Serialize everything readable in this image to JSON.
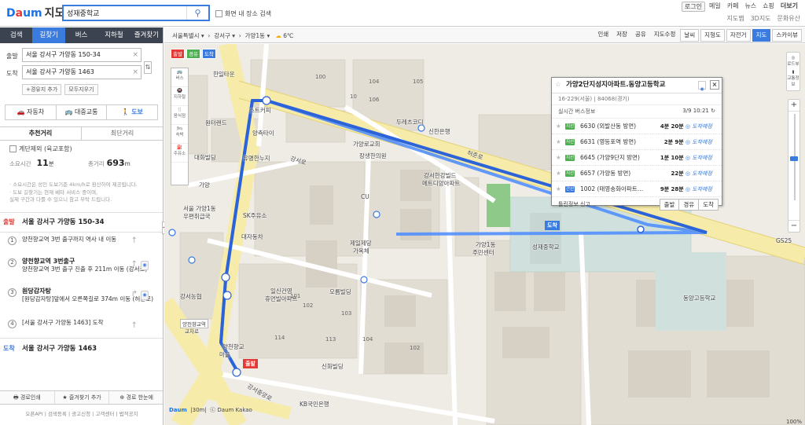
{
  "header": {
    "logo": "Daum",
    "logo_suffix": "지도",
    "search_value": "성재중학교",
    "checkbox_label": "화면 내 장소 검색",
    "links_top": [
      "로그인",
      "메일",
      "카페",
      "뉴스",
      "쇼핑",
      "더보기"
    ],
    "links_sub": [
      "지도맵",
      "3D지도",
      "문화유산"
    ]
  },
  "left": {
    "tabs": [
      "검색",
      "길찾기",
      "버스",
      "지하철",
      "즐겨찾기"
    ],
    "start_label": "출발",
    "start_value": "서울 강서구 가양동 150-34",
    "dest_label": "도착",
    "dest_value": "서울 강서구 가양동 1463",
    "add_waypoint": "+경유지 추가",
    "reset": "모두지우기",
    "modes": [
      "자동차",
      "대중교통",
      "도보"
    ],
    "sub_tabs": [
      "추천거리",
      "최단거리"
    ],
    "stairs_label": "계단제외 (육교포함)",
    "time_label": "소요시간",
    "time_value": "11",
    "time_unit": "분",
    "dist_label": "총거리",
    "dist_value": "693",
    "dist_unit": "m",
    "notice": [
      "· 소요시간은 성인 도보기준 4km/h로 환산하여 제공됩니다.",
      "· 도보 길찾기는 현재 베타 서비스 중이며,",
      "  실제 구간과 다를 수 있으니 참고 부탁 드립니다."
    ],
    "start_tag": "출발",
    "start_step": "서울 강서구 가양동 150-34",
    "steps": [
      {
        "num": "1",
        "title": "",
        "text": "양천향교역 3번 출구까지 역사 내 이동"
      },
      {
        "num": "2",
        "title": "양천향교역 3번출구",
        "text": "양천향교역 3번 출구 진출 후 211m 이동 (강서로)"
      },
      {
        "num": "3",
        "title": "원당감자탕",
        "text": "[원당감자탕]앞에서 오른쪽길로 374m 이동 (허준로)"
      },
      {
        "num": "4",
        "title": "",
        "text": "[서울 강서구 가양동 1463] 도착"
      }
    ],
    "dest_tag": "도착",
    "dest_step": "서울 강서구 가양동 1463",
    "footer_buttons": [
      "경로인쇄",
      "즐겨찾기 추가",
      "경로 한눈에"
    ],
    "footer_links": "오픈API | 검색등록 | 광고신청 | 고객센터 | 법적공지"
  },
  "mapbar": {
    "crumb": [
      "서울특별시",
      "강서구",
      "가양1동"
    ],
    "temp": "6℃",
    "tools": [
      "인쇄",
      "저장",
      "공유",
      "지도수정"
    ],
    "layers": [
      "날씨",
      "지형도",
      "자전거"
    ],
    "types": [
      "지도",
      "스카이뷰"
    ]
  },
  "map": {
    "route_buttons": [
      "출발",
      "경유",
      "도착"
    ],
    "vtools": [
      "버스",
      "지하철",
      "음식점",
      "숙박",
      "주유소"
    ],
    "labels": [
      "한일타운",
      "원터랜드",
      "스트커피",
      "연산",
      "양측타이",
      "유명한누지",
      "수해기",
      "대화빌딩",
      "가양",
      "중문",
      "서울 가양1동",
      "우편취급국",
      "SK주유소",
      "대자동차",
      "강서초",
      "강서농협",
      "양천향교역",
      "교차로",
      "양천향교",
      "마을",
      "신향교",
      "대포스역",
      "KB국민은행",
      "신화빌딩",
      "일신건영",
      "휴먼빌아파트",
      "일인로",
      "오름빌딩",
      "두레츠코디",
      "신한은행",
      "가양로교회",
      "장생한의원",
      "강서한강빌드",
      "메트디앙아파트",
      "CU",
      "제일제당",
      "가옥체",
      "가양1동",
      "주민센터",
      "성재중학교",
      "동양고등학교",
      "허준로",
      "강서로",
      "GS25",
      "강서중앙로"
    ],
    "numbers": [
      "100",
      "10",
      "104",
      "105",
      "106",
      "101",
      "102",
      "103",
      "114",
      "113",
      "104",
      "102",
      "101",
      "103",
      "107",
      "106",
      "105"
    ],
    "start_marker": "출발",
    "dest_marker": "도착",
    "scale": "30m",
    "zoom_pct": "100%",
    "daum_logo": "Daum",
    "copyright": "ⓒ Daum Kakao",
    "right_tools": [
      "로드뷰",
      "교통정보"
    ]
  },
  "popup": {
    "title": "가양2단지성지아파트.동양고등학교",
    "sub": "16-229(서울) | 84068(경기)",
    "realtime_label": "실시간 버스정보",
    "time": "3/9 10:21",
    "buses": [
      {
        "tag": "지선",
        "route": "6630 (외발산동 방면)",
        "min": "4분",
        "sec": "20분",
        "state": "도착예정"
      },
      {
        "tag": "지선",
        "route": "6631 (영등포역 방면)",
        "min": "2분",
        "sec": "9분",
        "state": "도착예정"
      },
      {
        "tag": "지선",
        "route": "6645 (가양9단지 방면)",
        "min": "1분",
        "sec": "10분",
        "state": "도착예정"
      },
      {
        "tag": "지선",
        "route": "6657 (가양동 방면)",
        "min": "",
        "sec": "22분",
        "state": "도착예정"
      },
      {
        "tag": "간선",
        "route": "1002 (태영송화아파트…",
        "min": "9분",
        "sec": "28분",
        "state": "도착예정"
      }
    ],
    "report": "틀린정보 신고",
    "btns": [
      "출발",
      "경유",
      "도착"
    ]
  },
  "colors": {
    "accent": "#3a7be0",
    "start": "#e53935",
    "dest": "#3a7be0",
    "road": "#f6eba8",
    "green": "#8fc98a"
  }
}
